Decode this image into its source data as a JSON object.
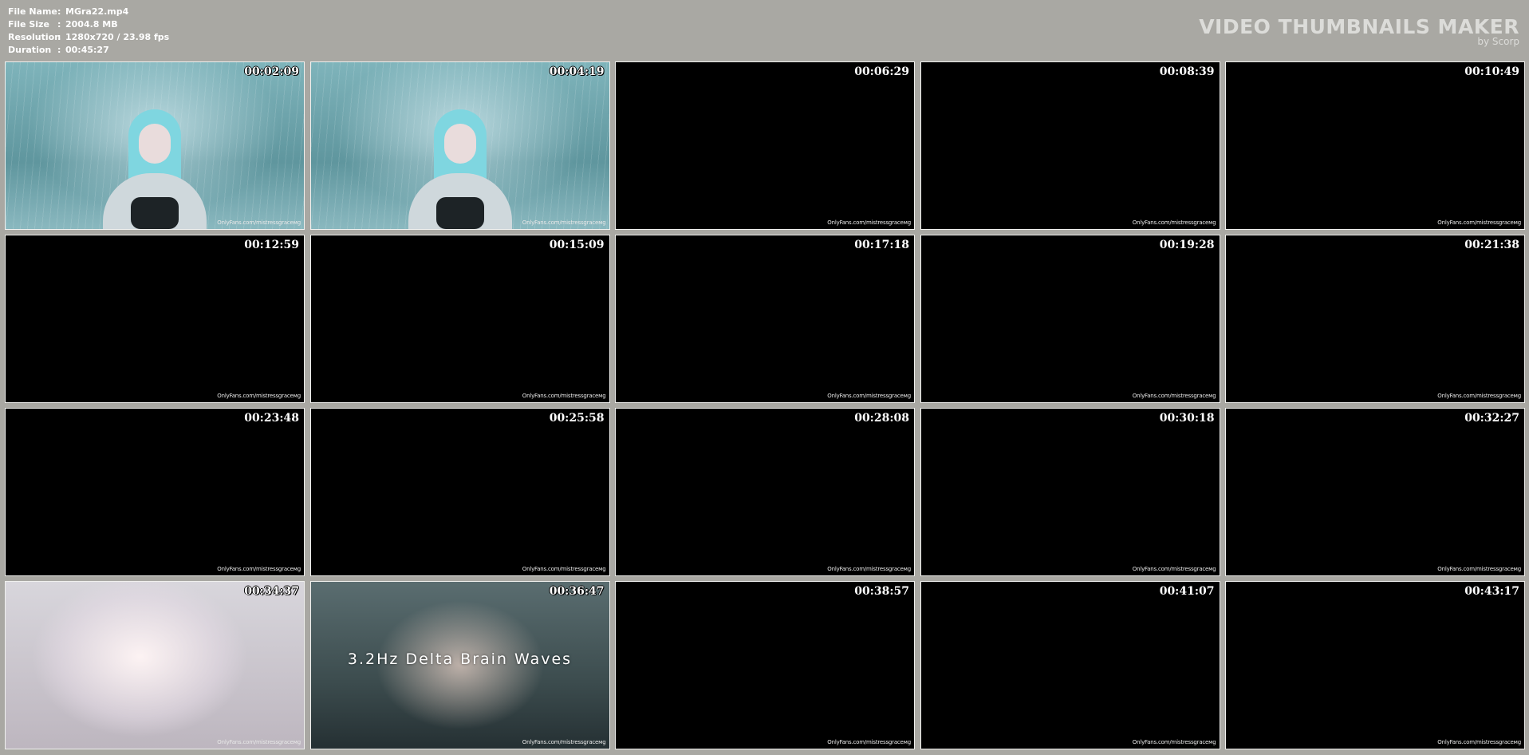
{
  "meta": {
    "rows": [
      {
        "label": "File Name",
        "value": "MGra22.mp4"
      },
      {
        "label": "File Size",
        "value": "2004.8 MB"
      },
      {
        "label": "Resolution",
        "value": "1280x720 / 23.98 fps"
      },
      {
        "label": "Duration",
        "value": "00:45:27"
      }
    ],
    "separator": ":"
  },
  "brand": {
    "title": "VIDEO THUMBNAILS MAKER",
    "subtitle": "by Scorp"
  },
  "watermark": "OnlyFans.com/mistressgraceмg",
  "thumbnails": [
    {
      "time": "00:02:09",
      "scene": "rain-blue"
    },
    {
      "time": "00:04:19",
      "scene": "rain-blue"
    },
    {
      "time": "00:06:29",
      "scene": "black"
    },
    {
      "time": "00:08:39",
      "scene": "black"
    },
    {
      "time": "00:10:49",
      "scene": "black"
    },
    {
      "time": "00:12:59",
      "scene": "black"
    },
    {
      "time": "00:15:09",
      "scene": "black"
    },
    {
      "time": "00:17:18",
      "scene": "black"
    },
    {
      "time": "00:19:28",
      "scene": "black"
    },
    {
      "time": "00:21:38",
      "scene": "black"
    },
    {
      "time": "00:23:48",
      "scene": "black"
    },
    {
      "time": "00:25:58",
      "scene": "black"
    },
    {
      "time": "00:28:08",
      "scene": "black"
    },
    {
      "time": "00:30:18",
      "scene": "black"
    },
    {
      "time": "00:32:27",
      "scene": "black"
    },
    {
      "time": "00:34:37",
      "scene": "bright-face"
    },
    {
      "time": "00:36:47",
      "scene": "delta",
      "caption": "3.2Hz Delta Brain Waves"
    },
    {
      "time": "00:38:57",
      "scene": "black"
    },
    {
      "time": "00:41:07",
      "scene": "black"
    },
    {
      "time": "00:43:17",
      "scene": "black"
    }
  ]
}
